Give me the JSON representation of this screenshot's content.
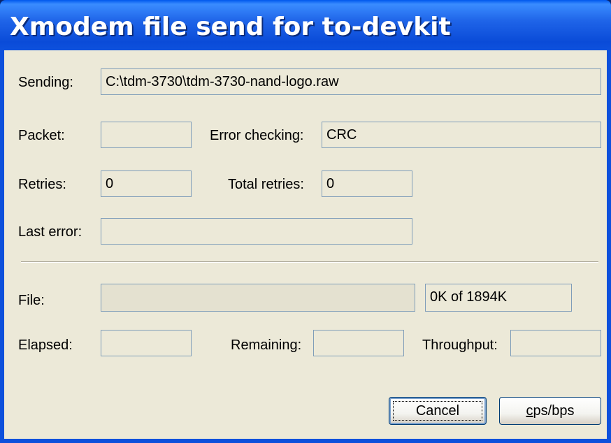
{
  "window": {
    "title": "Xmodem file send for to-devkit"
  },
  "labels": {
    "sending": "Sending:",
    "packet": "Packet:",
    "error_checking": "Error checking:",
    "retries": "Retries:",
    "total_retries": "Total retries:",
    "last_error": "Last error:",
    "file": "File:",
    "elapsed": "Elapsed:",
    "remaining": "Remaining:",
    "throughput": "Throughput:"
  },
  "values": {
    "sending": "C:\\tdm-3730\\tdm-3730-nand-logo.raw",
    "packet": "",
    "error_checking": "CRC",
    "retries": "0",
    "total_retries": "0",
    "last_error": "",
    "file_progress_fraction": 0,
    "file_size": "0K of 1894K",
    "elapsed": "",
    "remaining": "",
    "throughput": ""
  },
  "buttons": {
    "cancel": "Cancel",
    "cps_bps_mnemonic": "c",
    "cps_bps_rest": "ps/bps"
  }
}
